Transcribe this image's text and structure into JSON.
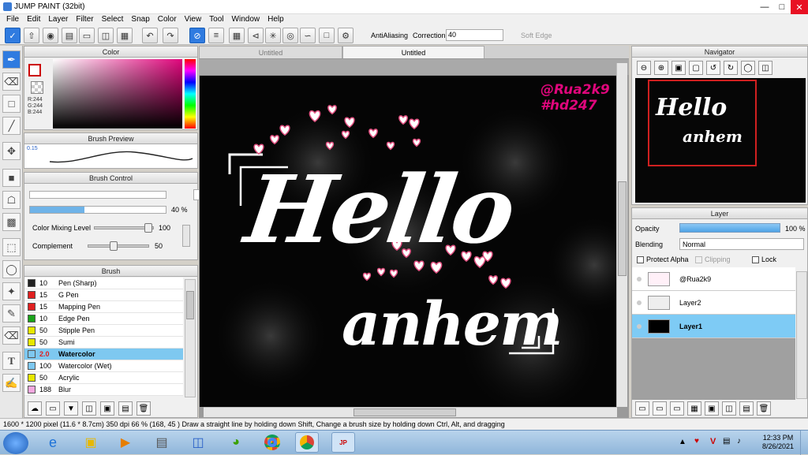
{
  "window": {
    "title": "JUMP PAINT (32bit)"
  },
  "menu": [
    "File",
    "Edit",
    "Layer",
    "Filter",
    "Select",
    "Snap",
    "Color",
    "View",
    "Tool",
    "Window",
    "Help"
  ],
  "toolbar": {
    "antialiasing_label": "AntiAliasing",
    "correction_label": "Correction",
    "correction_value": "40",
    "soft_edge_label": "Soft Edge"
  },
  "color_panel": {
    "title": "Color",
    "rgb": [
      "R:244",
      "G:244",
      "B:244"
    ],
    "accent": "#e0067c"
  },
  "brush_preview": {
    "title": "Brush Preview",
    "size": "0.15"
  },
  "brush_control": {
    "title": "Brush Control",
    "size_value": "2",
    "opacity_value": "40 %",
    "mixing_label": "Color Mixing Level",
    "mixing_value": "100",
    "complement_label": "Complement",
    "complement_value": "50"
  },
  "brush_panel": {
    "title": "Brush",
    "items": [
      {
        "size": "10",
        "name": "Pen (Sharp)",
        "color": "#222222"
      },
      {
        "size": "15",
        "name": "G Pen",
        "color": "#e02020"
      },
      {
        "size": "15",
        "name": "Mapping Pen",
        "color": "#e02020"
      },
      {
        "size": "10",
        "name": "Edge Pen",
        "color": "#1aa31a"
      },
      {
        "size": "50",
        "name": "Stipple Pen",
        "color": "#e8e800"
      },
      {
        "size": "50",
        "name": "Sumi",
        "color": "#e8e800"
      },
      {
        "size": "2.0",
        "name": "Watercolor",
        "color": "#7ec8f0"
      },
      {
        "size": "100",
        "name": "Watercolor (Wet)",
        "color": "#7ec8f0"
      },
      {
        "size": "50",
        "name": "Acrylic",
        "color": "#e8e800"
      },
      {
        "size": "188",
        "name": "Blur",
        "color": "#f4a8e0"
      }
    ]
  },
  "canvas": {
    "tabs": [
      "Untitled",
      "Untitled"
    ],
    "watermark": [
      "@Rua2k9",
      "#hd247"
    ],
    "text_line1": "Hello",
    "text_line2": "anhem"
  },
  "navigator": {
    "title": "Navigator"
  },
  "layer_panel": {
    "title": "Layer",
    "opacity_label": "Opacity",
    "opacity_value": "100 %",
    "blending_label": "Blending",
    "blending_value": "Normal",
    "protect_alpha": "Protect Alpha",
    "clipping": "Clipping",
    "lock": "Lock",
    "layers": [
      {
        "name": "@Rua2k9"
      },
      {
        "name": "Layer2"
      },
      {
        "name": "Layer1"
      }
    ]
  },
  "status": {
    "text": "1600 * 1200 pixel  (11.6 * 8.7cm)  350 dpi  66 %  (168, 45 )   Draw a straight line by holding down Shift, Change a brush size by holding down Ctrl, Alt, and dragging"
  },
  "taskbar": {
    "time": "12:33 PM",
    "date": "8/26/2021"
  }
}
